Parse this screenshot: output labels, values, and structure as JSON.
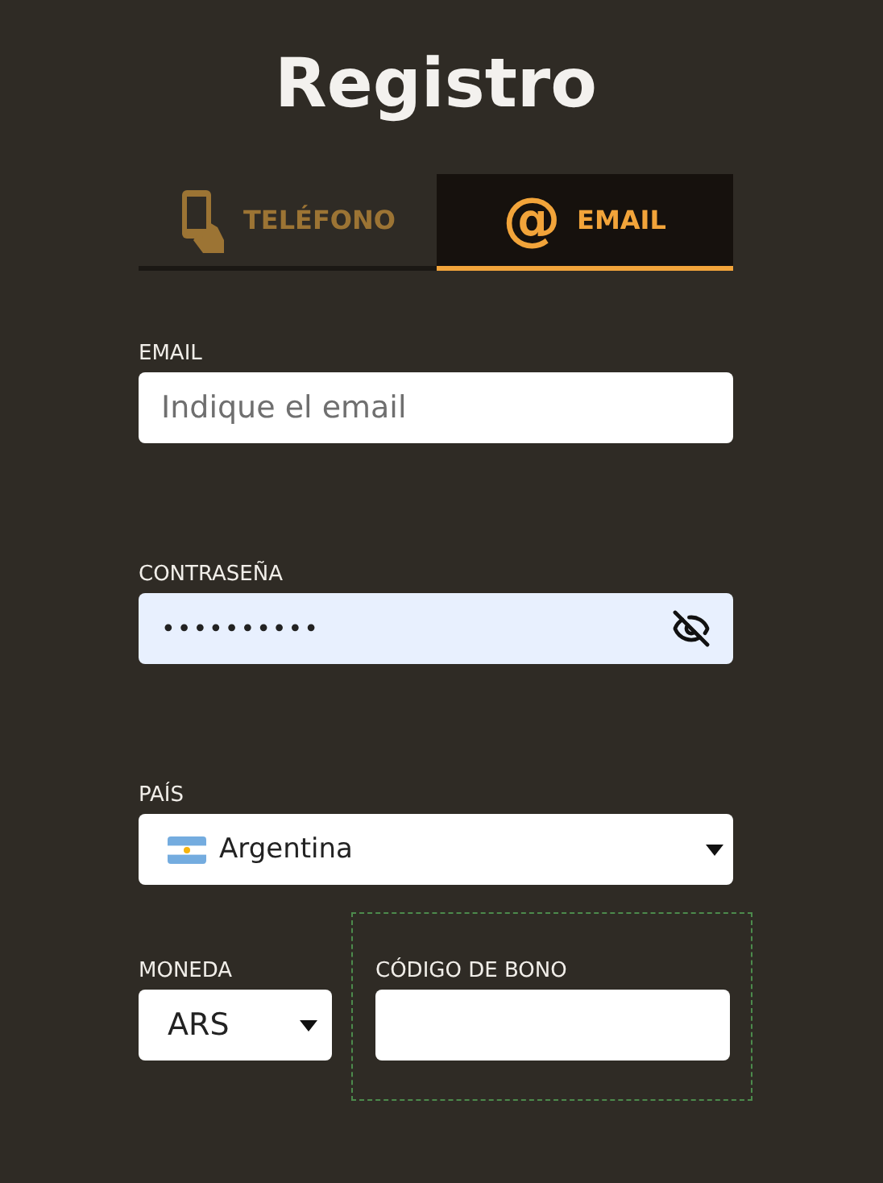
{
  "title": "Registro",
  "tabs": [
    {
      "kind": "phone",
      "label": "TELÉFONO",
      "selected": false
    },
    {
      "kind": "email",
      "icon": "@",
      "label": "EMAIL",
      "selected": true
    }
  ],
  "email": {
    "label": "EMAIL",
    "placeholder": "Indique el email"
  },
  "password": {
    "label": "CONTRASEÑA",
    "value": "••••••••••"
  },
  "country": {
    "label": "PAÍS",
    "value": "Argentina"
  },
  "currency": {
    "label": "MONEDA",
    "value": "ARS"
  },
  "bonus_code": {
    "label": "CÓDIGO DE BONO"
  }
}
